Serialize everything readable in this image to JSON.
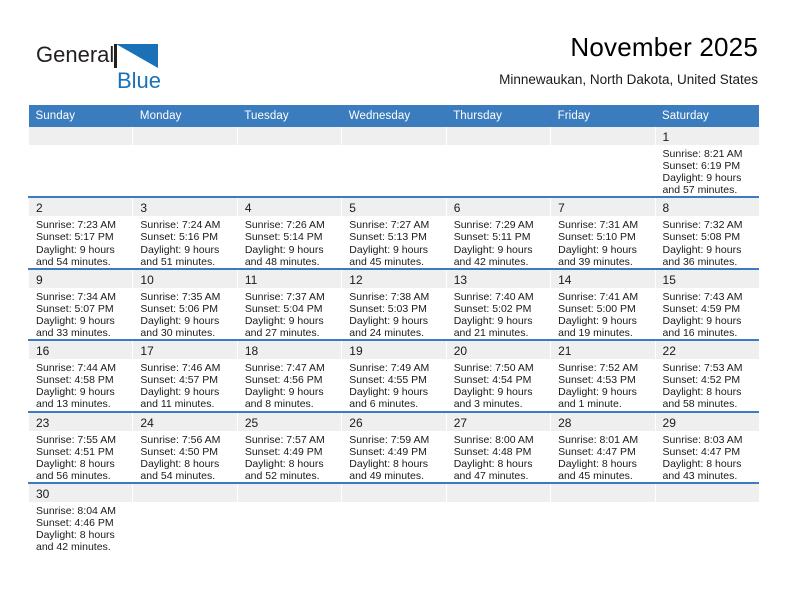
{
  "brand": {
    "name_part1": "General",
    "name_part2": "Blue",
    "triangle_icon": "triangle-icon",
    "accent_color": "#1a71b8"
  },
  "header": {
    "title": "November 2025",
    "subtitle": "Minnewaukan, North Dakota, United States"
  },
  "theme": {
    "header_blue": "#3a7cbe",
    "row_divider_blue": "#3a7cbe",
    "daynum_band": "#efefef",
    "text": "#1a1a1a"
  },
  "calendar": {
    "weekday_headers": [
      "Sunday",
      "Monday",
      "Tuesday",
      "Wednesday",
      "Thursday",
      "Friday",
      "Saturday"
    ],
    "weeks": [
      [
        {
          "day": "",
          "empty": true
        },
        {
          "day": "",
          "empty": true
        },
        {
          "day": "",
          "empty": true
        },
        {
          "day": "",
          "empty": true
        },
        {
          "day": "",
          "empty": true
        },
        {
          "day": "",
          "empty": true
        },
        {
          "day": "1",
          "sunrise": "Sunrise: 8:21 AM",
          "sunset": "Sunset: 6:19 PM",
          "daylight1": "Daylight: 9 hours",
          "daylight2": "and 57 minutes."
        }
      ],
      [
        {
          "day": "2",
          "sunrise": "Sunrise: 7:23 AM",
          "sunset": "Sunset: 5:17 PM",
          "daylight1": "Daylight: 9 hours",
          "daylight2": "and 54 minutes."
        },
        {
          "day": "3",
          "sunrise": "Sunrise: 7:24 AM",
          "sunset": "Sunset: 5:16 PM",
          "daylight1": "Daylight: 9 hours",
          "daylight2": "and 51 minutes."
        },
        {
          "day": "4",
          "sunrise": "Sunrise: 7:26 AM",
          "sunset": "Sunset: 5:14 PM",
          "daylight1": "Daylight: 9 hours",
          "daylight2": "and 48 minutes."
        },
        {
          "day": "5",
          "sunrise": "Sunrise: 7:27 AM",
          "sunset": "Sunset: 5:13 PM",
          "daylight1": "Daylight: 9 hours",
          "daylight2": "and 45 minutes."
        },
        {
          "day": "6",
          "sunrise": "Sunrise: 7:29 AM",
          "sunset": "Sunset: 5:11 PM",
          "daylight1": "Daylight: 9 hours",
          "daylight2": "and 42 minutes."
        },
        {
          "day": "7",
          "sunrise": "Sunrise: 7:31 AM",
          "sunset": "Sunset: 5:10 PM",
          "daylight1": "Daylight: 9 hours",
          "daylight2": "and 39 minutes."
        },
        {
          "day": "8",
          "sunrise": "Sunrise: 7:32 AM",
          "sunset": "Sunset: 5:08 PM",
          "daylight1": "Daylight: 9 hours",
          "daylight2": "and 36 minutes."
        }
      ],
      [
        {
          "day": "9",
          "sunrise": "Sunrise: 7:34 AM",
          "sunset": "Sunset: 5:07 PM",
          "daylight1": "Daylight: 9 hours",
          "daylight2": "and 33 minutes."
        },
        {
          "day": "10",
          "sunrise": "Sunrise: 7:35 AM",
          "sunset": "Sunset: 5:06 PM",
          "daylight1": "Daylight: 9 hours",
          "daylight2": "and 30 minutes."
        },
        {
          "day": "11",
          "sunrise": "Sunrise: 7:37 AM",
          "sunset": "Sunset: 5:04 PM",
          "daylight1": "Daylight: 9 hours",
          "daylight2": "and 27 minutes."
        },
        {
          "day": "12",
          "sunrise": "Sunrise: 7:38 AM",
          "sunset": "Sunset: 5:03 PM",
          "daylight1": "Daylight: 9 hours",
          "daylight2": "and 24 minutes."
        },
        {
          "day": "13",
          "sunrise": "Sunrise: 7:40 AM",
          "sunset": "Sunset: 5:02 PM",
          "daylight1": "Daylight: 9 hours",
          "daylight2": "and 21 minutes."
        },
        {
          "day": "14",
          "sunrise": "Sunrise: 7:41 AM",
          "sunset": "Sunset: 5:00 PM",
          "daylight1": "Daylight: 9 hours",
          "daylight2": "and 19 minutes."
        },
        {
          "day": "15",
          "sunrise": "Sunrise: 7:43 AM",
          "sunset": "Sunset: 4:59 PM",
          "daylight1": "Daylight: 9 hours",
          "daylight2": "and 16 minutes."
        }
      ],
      [
        {
          "day": "16",
          "sunrise": "Sunrise: 7:44 AM",
          "sunset": "Sunset: 4:58 PM",
          "daylight1": "Daylight: 9 hours",
          "daylight2": "and 13 minutes."
        },
        {
          "day": "17",
          "sunrise": "Sunrise: 7:46 AM",
          "sunset": "Sunset: 4:57 PM",
          "daylight1": "Daylight: 9 hours",
          "daylight2": "and 11 minutes."
        },
        {
          "day": "18",
          "sunrise": "Sunrise: 7:47 AM",
          "sunset": "Sunset: 4:56 PM",
          "daylight1": "Daylight: 9 hours",
          "daylight2": "and 8 minutes."
        },
        {
          "day": "19",
          "sunrise": "Sunrise: 7:49 AM",
          "sunset": "Sunset: 4:55 PM",
          "daylight1": "Daylight: 9 hours",
          "daylight2": "and 6 minutes."
        },
        {
          "day": "20",
          "sunrise": "Sunrise: 7:50 AM",
          "sunset": "Sunset: 4:54 PM",
          "daylight1": "Daylight: 9 hours",
          "daylight2": "and 3 minutes."
        },
        {
          "day": "21",
          "sunrise": "Sunrise: 7:52 AM",
          "sunset": "Sunset: 4:53 PM",
          "daylight1": "Daylight: 9 hours",
          "daylight2": "and 1 minute."
        },
        {
          "day": "22",
          "sunrise": "Sunrise: 7:53 AM",
          "sunset": "Sunset: 4:52 PM",
          "daylight1": "Daylight: 8 hours",
          "daylight2": "and 58 minutes."
        }
      ],
      [
        {
          "day": "23",
          "sunrise": "Sunrise: 7:55 AM",
          "sunset": "Sunset: 4:51 PM",
          "daylight1": "Daylight: 8 hours",
          "daylight2": "and 56 minutes."
        },
        {
          "day": "24",
          "sunrise": "Sunrise: 7:56 AM",
          "sunset": "Sunset: 4:50 PM",
          "daylight1": "Daylight: 8 hours",
          "daylight2": "and 54 minutes."
        },
        {
          "day": "25",
          "sunrise": "Sunrise: 7:57 AM",
          "sunset": "Sunset: 4:49 PM",
          "daylight1": "Daylight: 8 hours",
          "daylight2": "and 52 minutes."
        },
        {
          "day": "26",
          "sunrise": "Sunrise: 7:59 AM",
          "sunset": "Sunset: 4:49 PM",
          "daylight1": "Daylight: 8 hours",
          "daylight2": "and 49 minutes."
        },
        {
          "day": "27",
          "sunrise": "Sunrise: 8:00 AM",
          "sunset": "Sunset: 4:48 PM",
          "daylight1": "Daylight: 8 hours",
          "daylight2": "and 47 minutes."
        },
        {
          "day": "28",
          "sunrise": "Sunrise: 8:01 AM",
          "sunset": "Sunset: 4:47 PM",
          "daylight1": "Daylight: 8 hours",
          "daylight2": "and 45 minutes."
        },
        {
          "day": "29",
          "sunrise": "Sunrise: 8:03 AM",
          "sunset": "Sunset: 4:47 PM",
          "daylight1": "Daylight: 8 hours",
          "daylight2": "and 43 minutes."
        }
      ],
      [
        {
          "day": "30",
          "sunrise": "Sunrise: 8:04 AM",
          "sunset": "Sunset: 4:46 PM",
          "daylight1": "Daylight: 8 hours",
          "daylight2": "and 42 minutes."
        },
        {
          "day": "",
          "empty": true
        },
        {
          "day": "",
          "empty": true
        },
        {
          "day": "",
          "empty": true
        },
        {
          "day": "",
          "empty": true
        },
        {
          "day": "",
          "empty": true
        },
        {
          "day": "",
          "empty": true
        }
      ]
    ]
  }
}
